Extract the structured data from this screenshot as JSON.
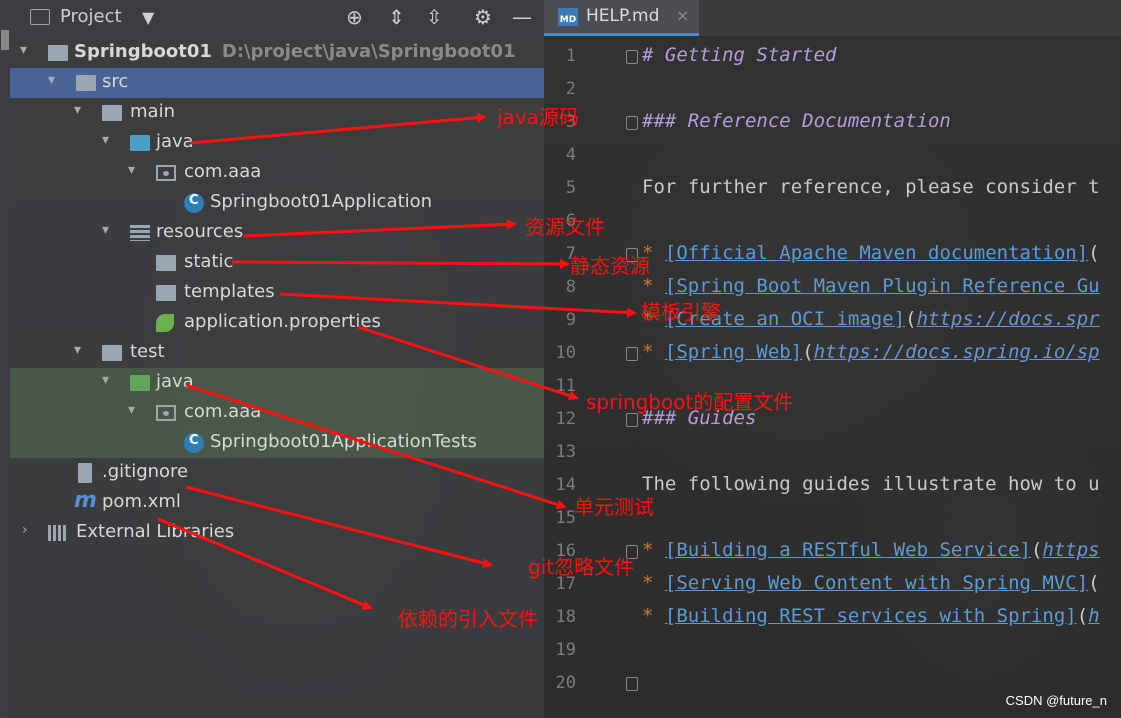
{
  "project_panel": {
    "title": "Project",
    "caret": "▼",
    "header_icons": [
      "crosshair-icon",
      "expand-all-icon",
      "collapse-all-icon",
      "gear-icon",
      "minimize-icon"
    ],
    "tree": [
      {
        "label": "Springboot01",
        "path": "D:\\project\\java\\Springboot01",
        "icon": "module-icon",
        "expanded": true
      },
      {
        "label": "src",
        "icon": "folder-icon",
        "expanded": true,
        "selected": true
      },
      {
        "label": "main",
        "icon": "folder-icon",
        "expanded": true
      },
      {
        "label": "java",
        "icon": "source-folder-icon",
        "expanded": true
      },
      {
        "label": "com.aaa",
        "icon": "package-icon",
        "expanded": true
      },
      {
        "label": "Springboot01Application",
        "icon": "spring-class-icon"
      },
      {
        "label": "resources",
        "icon": "resources-folder-icon",
        "expanded": true
      },
      {
        "label": "static",
        "icon": "folder-icon"
      },
      {
        "label": "templates",
        "icon": "folder-icon"
      },
      {
        "label": "application.properties",
        "icon": "spring-properties-icon"
      },
      {
        "label": "test",
        "icon": "folder-icon",
        "expanded": true
      },
      {
        "label": "java",
        "icon": "test-folder-icon",
        "expanded": true,
        "highlight": true
      },
      {
        "label": "com.aaa",
        "icon": "package-icon",
        "expanded": true,
        "highlight": true
      },
      {
        "label": "Springboot01ApplicationTests",
        "icon": "spring-class-icon",
        "highlight": true
      },
      {
        "label": ".gitignore",
        "icon": "file-icon"
      },
      {
        "label": "pom.xml",
        "icon": "maven-icon"
      },
      {
        "label": "External Libraries",
        "icon": "library-icon",
        "collapsed": true
      }
    ]
  },
  "editor": {
    "tab_label": "HELP.md",
    "tab_icon_text": "MD",
    "tab_close": "×",
    "line_numbers": [
      "1",
      "2",
      "3",
      "4",
      "5",
      "6",
      "7",
      "8",
      "9",
      "10",
      "11",
      "12",
      "13",
      "14",
      "15",
      "16",
      "17",
      "18",
      "19",
      "20"
    ],
    "lines": {
      "l1": "# Getting Started",
      "l3": "### Reference Documentation",
      "l5": "For further reference, please consider t",
      "l7_link": "[Official Apache Maven documentation]",
      "l7_tail": "(",
      "l8_link": "[Spring Boot Maven Plugin Reference Gu",
      "l9_link": "[Create an OCI image]",
      "l9_tail_open": "(",
      "l9_url": "https://docs.spr",
      "l10_link": "[Spring Web]",
      "l10_tail_open": "(",
      "l10_url": "https://docs.spring.io/sp",
      "l12": "### Guides",
      "l14": "The following guides illustrate how to u",
      "l16_link": "[Building a RESTful Web Service]",
      "l16_tail_open": "(",
      "l16_url": "https",
      "l17_link": "[Serving Web Content with Spring MVC]",
      "l17_tail": "(",
      "l18_link": "[Building REST services with Spring]",
      "l18_tail_open": "(",
      "l18_url": "h",
      "bullet": "*"
    }
  },
  "annotations": {
    "java_source": "java源码",
    "resource_files": "资源文件",
    "static_resources": "静态资源",
    "template_engine": "模板引擎",
    "config_file": "springboot的配置文件",
    "unit_test": "单元测试",
    "git_ignore": "git忽略文件",
    "dependency_file": "依赖的引入文件"
  },
  "watermark": "CSDN @future_n",
  "colors": {
    "annotation": "#ff1010",
    "selection": "#4a6397",
    "link": "#5b9bd8",
    "heading": "#b39ddb",
    "bullet": "#cc7832"
  }
}
